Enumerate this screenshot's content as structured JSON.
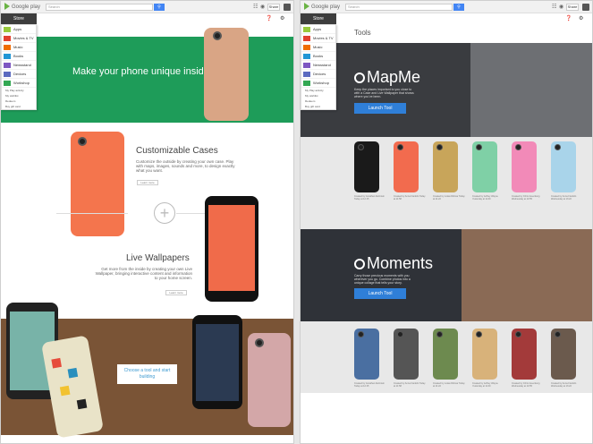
{
  "left": {
    "logo_text": "Google play",
    "search_placeholder": "Search",
    "share_label": "Share",
    "store_label": "Store",
    "menu": [
      {
        "label": "Apps",
        "color": "#98c93c"
      },
      {
        "label": "Movies & TV",
        "color": "#e2402f"
      },
      {
        "label": "Music",
        "color": "#ef6c00"
      },
      {
        "label": "Books",
        "color": "#2196d5"
      },
      {
        "label": "Newsstand",
        "color": "#7e57c2"
      },
      {
        "label": "Devices",
        "color": "#5c6bc0"
      },
      {
        "label": "Workshop",
        "color": "#33a853"
      }
    ],
    "menu_links": [
      "My Play activity",
      "My wishlist",
      "Redeem",
      "Buy gift card"
    ],
    "hero_text": "Make your phone unique inside and out.",
    "cases_title": "Customizable Cases",
    "cases_body": "Customize the outside by creating your own case. Play with maps, images, sounds and more, to design exactly what you want.",
    "cases_button": "Learn more",
    "wallpapers_title": "Live Wallpapers",
    "wallpapers_body": "Get more from the inside by creating your own Live Wallpaper, bringing interactive content and information to your home screen.",
    "wallpapers_button": "Learn more",
    "cta_text": "Choose a tool and start building"
  },
  "right": {
    "logo_text": "Google play",
    "search_placeholder": "Search",
    "share_label": "Share",
    "store_label": "Store",
    "menu": [
      {
        "label": "Apps",
        "color": "#98c93c"
      },
      {
        "label": "Movies & TV",
        "color": "#e2402f"
      },
      {
        "label": "Music",
        "color": "#ef6c00"
      },
      {
        "label": "Books",
        "color": "#2196d5"
      },
      {
        "label": "Newsstand",
        "color": "#7e57c2"
      },
      {
        "label": "Devices",
        "color": "#5c6bc0"
      },
      {
        "label": "Workshop",
        "color": "#33a853"
      }
    ],
    "menu_links": [
      "My Play activity",
      "My wishlist",
      "Redeem",
      "Buy gift card"
    ],
    "tools_title": "Tools",
    "mapme_title": "MapMe",
    "mapme_body": "Keep the places important to you close to with a Case and Live Wallpaper that shows where you've been.",
    "mapme_button": "Launch Tool",
    "moments_title": "Moments",
    "moments_body": "Carry those precious moments with you wherever you go. Combine photos into a unique collage that tells your story.",
    "moments_button": "Launch Tool",
    "map_cases": [
      {
        "color": "#1a1a1a",
        "caption": "Created by Jonathan Zwirnlein Today at 12:15"
      },
      {
        "color": "#f26b4e",
        "caption": "Created by Anna Franklin Today at 11:58"
      },
      {
        "color": "#c8a55a",
        "caption": "Created by Lukas Dittmar Today at 11:22"
      },
      {
        "color": "#7fd0a6",
        "caption": "Created by Jeffrey Wayne Yesterday at 11:40"
      },
      {
        "color": "#f28ab8",
        "caption": "Created by Chris Greenberg Wednesday at 14:55"
      },
      {
        "color": "#a9d4ea",
        "caption": "Created by Anna Franklin Wednesday at 13:22"
      }
    ],
    "photo_cases": [
      {
        "color": "#4a6fa1",
        "caption": "Created by Jonathan Zwirnlein Today at 12:15"
      },
      {
        "color": "#555555",
        "caption": "Created by Anna Franklin Today at 11:58"
      },
      {
        "color": "#6d8a4f",
        "caption": "Created by Lukas Dittmar Today at 11:22"
      },
      {
        "color": "#d8b27a",
        "caption": "Created by Jeffrey Wayne Yesterday at 11:40"
      },
      {
        "color": "#a33a3a",
        "caption": "Created by Chris Greenberg Wednesday at 14:55"
      },
      {
        "color": "#6b5a4d",
        "caption": "Created by Anna Franklin Wednesday at 13:22"
      }
    ]
  }
}
